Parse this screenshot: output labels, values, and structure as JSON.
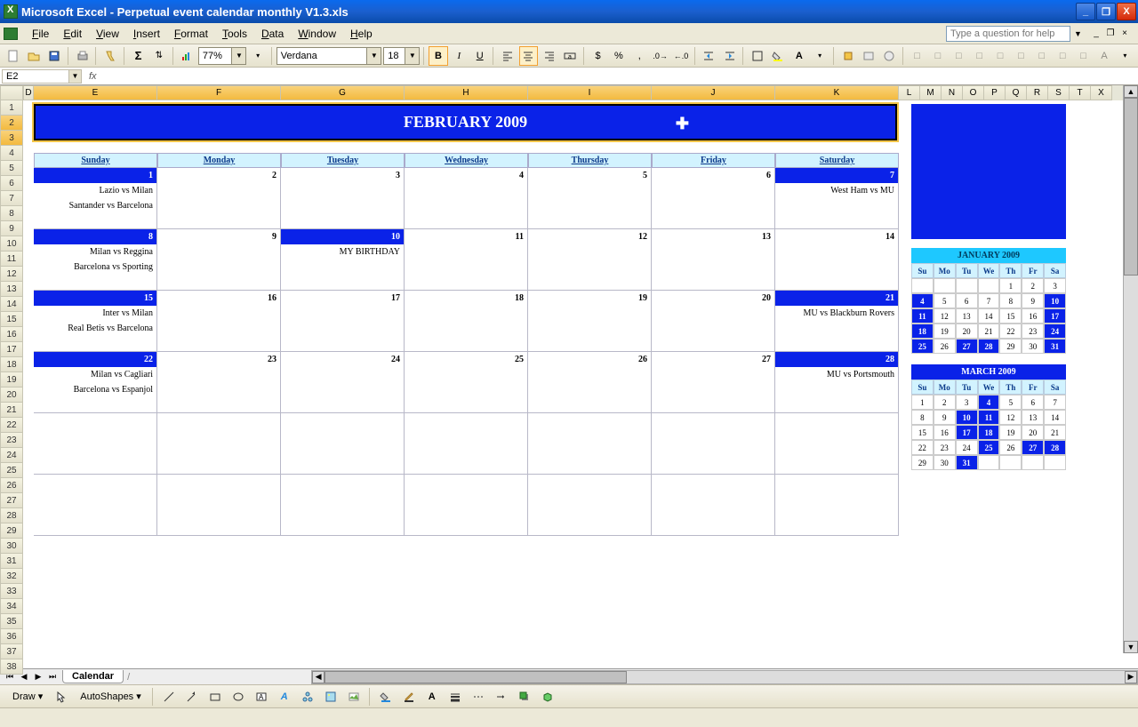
{
  "window": {
    "title": "Microsoft Excel - Perpetual event calendar monthly V1.3.xls"
  },
  "menu": {
    "items": [
      "File",
      "Edit",
      "View",
      "Insert",
      "Format",
      "Tools",
      "Data",
      "Window",
      "Help"
    ],
    "help_placeholder": "Type a question for help"
  },
  "toolbar": {
    "zoom": "77%",
    "font_name": "Verdana",
    "font_size": "18"
  },
  "formula": {
    "namebox": "E2",
    "fx_label": "fx",
    "value": ""
  },
  "columns": [
    "D",
    "E",
    "F",
    "G",
    "H",
    "I",
    "J",
    "K",
    "L",
    "M",
    "N",
    "O",
    "P",
    "Q",
    "R",
    "S",
    "T",
    "X"
  ],
  "rows_visible": 38,
  "calendar": {
    "title": "FEBRUARY 2009",
    "days": [
      "Sunday",
      "Monday",
      "Tuesday",
      "Wednesday",
      "Thursday",
      "Friday",
      "Saturday"
    ],
    "weeks": [
      {
        "dates": [
          1,
          2,
          3,
          4,
          5,
          6,
          7
        ],
        "hl": [
          true,
          false,
          false,
          false,
          false,
          false,
          true
        ],
        "events": [
          [
            "Lazio vs Milan",
            "Santander vs Barcelona"
          ],
          [],
          [],
          [],
          [],
          [],
          [
            "West Ham vs MU"
          ]
        ]
      },
      {
        "dates": [
          8,
          9,
          10,
          11,
          12,
          13,
          14
        ],
        "hl": [
          true,
          false,
          true,
          false,
          false,
          false,
          false
        ],
        "events": [
          [
            "Milan vs Reggina",
            "Barcelona vs Sporting"
          ],
          [],
          [
            "MY BIRTHDAY"
          ],
          [],
          [],
          [],
          []
        ]
      },
      {
        "dates": [
          15,
          16,
          17,
          18,
          19,
          20,
          21
        ],
        "hl": [
          true,
          false,
          false,
          false,
          false,
          false,
          true
        ],
        "events": [
          [
            "Inter vs Milan",
            "Real Betis vs Barcelona"
          ],
          [],
          [],
          [],
          [],
          [],
          [
            "MU vs Blackburn Rovers"
          ]
        ]
      },
      {
        "dates": [
          22,
          23,
          24,
          25,
          26,
          27,
          28
        ],
        "hl": [
          true,
          false,
          false,
          false,
          false,
          false,
          true
        ],
        "events": [
          [
            "Milan vs Cagliari",
            "Barcelona vs Espanjol"
          ],
          [],
          [],
          [],
          [],
          [],
          [
            "MU vs Portsmouth"
          ]
        ]
      },
      {
        "dates": [
          "",
          "",
          "",
          "",
          "",
          "",
          ""
        ],
        "hl": [
          false,
          false,
          false,
          false,
          false,
          false,
          false
        ],
        "events": [
          [],
          [],
          [],
          [],
          [],
          [],
          []
        ]
      },
      {
        "dates": [
          "",
          "",
          "",
          "",
          "",
          "",
          ""
        ],
        "hl": [
          false,
          false,
          false,
          false,
          false,
          false,
          false
        ],
        "events": [
          [],
          [],
          [],
          [],
          [],
          [],
          []
        ]
      }
    ]
  },
  "mini": [
    {
      "title": "JANUARY 2009",
      "cls": "jan",
      "dh": [
        "Su",
        "Mo",
        "Tu",
        "We",
        "Th",
        "Fr",
        "Sa"
      ],
      "cells": [
        [
          "",
          ""
        ],
        [
          "",
          ""
        ],
        [
          "",
          ""
        ],
        [
          "",
          ""
        ],
        [
          "1",
          ""
        ],
        [
          "2",
          ""
        ],
        [
          "3",
          ""
        ],
        [
          "4",
          "hl"
        ],
        [
          "5",
          ""
        ],
        [
          "6",
          ""
        ],
        [
          "7",
          ""
        ],
        [
          "8",
          ""
        ],
        [
          "9",
          ""
        ],
        [
          "10",
          "hl"
        ],
        [
          "11",
          "hl"
        ],
        [
          "12",
          ""
        ],
        [
          "13",
          ""
        ],
        [
          "14",
          ""
        ],
        [
          "15",
          ""
        ],
        [
          "16",
          ""
        ],
        [
          "17",
          "hl"
        ],
        [
          "18",
          "hl"
        ],
        [
          "19",
          ""
        ],
        [
          "20",
          ""
        ],
        [
          "21",
          ""
        ],
        [
          "22",
          ""
        ],
        [
          "23",
          ""
        ],
        [
          "24",
          "hl"
        ],
        [
          "25",
          "hl"
        ],
        [
          "26",
          ""
        ],
        [
          "27",
          "hl"
        ],
        [
          "28",
          "hl"
        ],
        [
          "29",
          ""
        ],
        [
          "30",
          ""
        ],
        [
          "31",
          "hl"
        ]
      ]
    },
    {
      "title": "MARCH 2009",
      "cls": "mar",
      "dh": [
        "Su",
        "Mo",
        "Tu",
        "We",
        "Th",
        "Fr",
        "Sa"
      ],
      "cells": [
        [
          "1",
          ""
        ],
        [
          "2",
          ""
        ],
        [
          "3",
          ""
        ],
        [
          "4",
          "hl"
        ],
        [
          "5",
          ""
        ],
        [
          "6",
          ""
        ],
        [
          "7",
          ""
        ],
        [
          "8",
          ""
        ],
        [
          "9",
          ""
        ],
        [
          "10",
          "hl"
        ],
        [
          "11",
          "hl"
        ],
        [
          "12",
          ""
        ],
        [
          "13",
          ""
        ],
        [
          "14",
          ""
        ],
        [
          "15",
          ""
        ],
        [
          "16",
          ""
        ],
        [
          "17",
          "hl"
        ],
        [
          "18",
          "hl"
        ],
        [
          "19",
          ""
        ],
        [
          "20",
          ""
        ],
        [
          "21",
          ""
        ],
        [
          "22",
          ""
        ],
        [
          "23",
          ""
        ],
        [
          "24",
          ""
        ],
        [
          "25",
          "hl"
        ],
        [
          "26",
          ""
        ],
        [
          "27",
          "hl"
        ],
        [
          "28",
          "hl"
        ],
        [
          "29",
          ""
        ],
        [
          "30",
          ""
        ],
        [
          "31",
          "hl"
        ],
        [
          "",
          ""
        ],
        [
          "",
          ""
        ],
        [
          "",
          ""
        ],
        [
          "",
          ""
        ]
      ]
    }
  ],
  "tabs": {
    "sheet": "Calendar"
  },
  "drawbar": {
    "draw": "Draw",
    "autoshapes": "AutoShapes"
  }
}
